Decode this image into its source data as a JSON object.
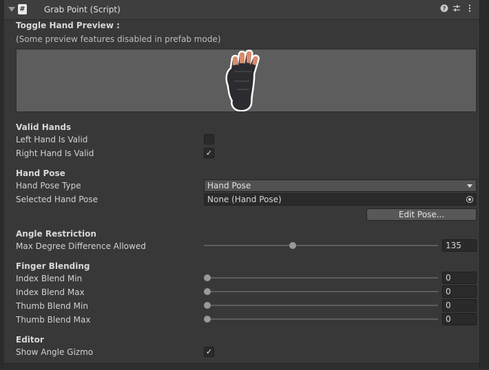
{
  "header": {
    "title": "Grab Point (Script)",
    "script_glyph": "#",
    "icons": [
      "help-icon",
      "presets-icon",
      "more-menu-icon"
    ]
  },
  "preview": {
    "toggle_label": "Toggle Hand Preview :",
    "note": "(Some preview features disabled in prefab mode)"
  },
  "valid_hands": {
    "heading": "Valid Hands",
    "left_label": "Left Hand Is Valid",
    "left_checked": false,
    "right_label": "Right Hand Is Valid",
    "right_checked": true
  },
  "hand_pose": {
    "heading": "Hand Pose",
    "type_label": "Hand Pose Type",
    "type_value": "Hand Pose",
    "selected_label": "Selected Hand Pose",
    "selected_value": "None (Hand Pose)",
    "edit_button": "Edit Pose..."
  },
  "angle": {
    "heading": "Angle Restriction",
    "max_label": "Max Degree Difference Allowed",
    "max_value": "135"
  },
  "finger": {
    "heading": "Finger Blending",
    "rows": [
      {
        "label": "Index Blend Min",
        "value": "0"
      },
      {
        "label": "Index Blend Max",
        "value": "0"
      },
      {
        "label": "Thumb Blend Min",
        "value": "0"
      },
      {
        "label": "Thumb Blend Max",
        "value": "0"
      }
    ]
  },
  "editor": {
    "heading": "Editor",
    "gizmo_label": "Show Angle Gizmo",
    "gizmo_checked": true
  },
  "glyphs": {
    "check": "✓"
  }
}
